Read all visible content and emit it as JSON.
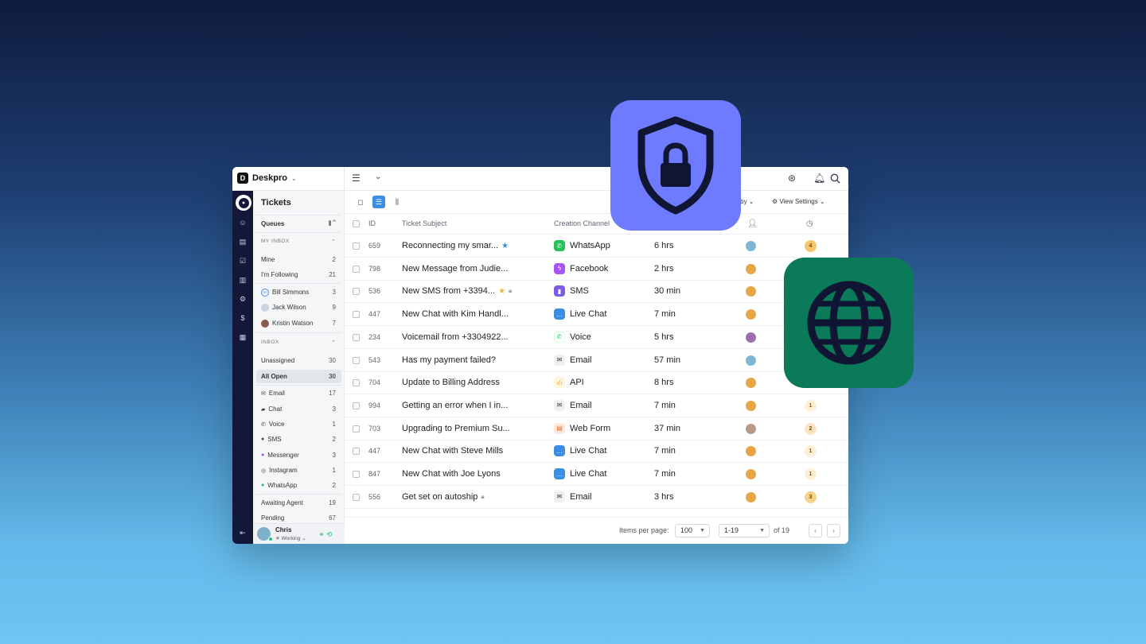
{
  "app": {
    "name": "Deskpro",
    "section": "Tickets"
  },
  "colors": {
    "nav_bg": "#13183a",
    "accent": "#3b8ee3",
    "shield_tile": "#6e7bff",
    "globe_tile": "#0a7a58"
  },
  "queues": {
    "title": "Queues",
    "my_inbox_header": "MY INBOX",
    "inbox_header": "INBOX",
    "my_inbox": [
      {
        "label": "Mine",
        "count": "2"
      },
      {
        "label": "I'm Following",
        "count": "21"
      }
    ],
    "agents": [
      {
        "label": "Bill Simmons",
        "count": "3",
        "initials": "BS"
      },
      {
        "label": "Jack Wilson",
        "count": "9"
      },
      {
        "label": "Kristin Watson",
        "count": "7"
      }
    ],
    "inbox": [
      {
        "label": "Unassigned",
        "count": "30"
      },
      {
        "label": "All Open",
        "count": "30"
      }
    ],
    "channels": [
      {
        "label": "Email",
        "count": "17",
        "icon": "email-icon"
      },
      {
        "label": "Chat",
        "count": "3",
        "icon": "chat-icon"
      },
      {
        "label": "Voice",
        "count": "1",
        "icon": "phone-icon"
      },
      {
        "label": "SMS",
        "count": "2",
        "icon": "sms-icon"
      },
      {
        "label": "Messenger",
        "count": "3",
        "icon": "messenger-icon"
      },
      {
        "label": "Instagram",
        "count": "1",
        "icon": "instagram-icon"
      },
      {
        "label": "WhatsApp",
        "count": "2",
        "icon": "whatsapp-icon"
      }
    ],
    "other": [
      {
        "label": "Awaiting Agent",
        "count": "19"
      },
      {
        "label": "Pending",
        "count": "67"
      }
    ]
  },
  "user": {
    "name": "Chris",
    "status": "Working"
  },
  "toolbar": {
    "group_by": "up by",
    "view_settings": "View Settings"
  },
  "table": {
    "headers": {
      "id": "ID",
      "subject": "Ticket Subject",
      "channel": "Creation Channel"
    },
    "rows": [
      {
        "id": "659",
        "subject": "Reconnecting my smar...",
        "star": true,
        "lock": false,
        "channel": "WhatsApp",
        "time": "6 hrs",
        "badge": "4"
      },
      {
        "id": "798",
        "subject": "New Message from Judie...",
        "star": false,
        "lock": false,
        "channel": "Facebook",
        "time": "2 hrs",
        "badge": ""
      },
      {
        "id": "536",
        "subject": "New SMS from +3394...",
        "star": true,
        "lock": true,
        "channel": "SMS",
        "time": "30 min",
        "badge": ""
      },
      {
        "id": "447",
        "subject": "New Chat with Kim Handl...",
        "star": false,
        "lock": false,
        "channel": "Live Chat",
        "time": "7 min",
        "badge": ""
      },
      {
        "id": "234",
        "subject": "Voicemail from +3304922...",
        "star": false,
        "lock": false,
        "channel": "Voice",
        "time": "5 hrs",
        "badge": ""
      },
      {
        "id": "543",
        "subject": "Has my payment failed?",
        "star": false,
        "lock": false,
        "channel": "Email",
        "time": "57 min",
        "badge": ""
      },
      {
        "id": "704",
        "subject": "Update to Billing Address",
        "star": false,
        "lock": false,
        "channel": "API",
        "time": "8 hrs",
        "badge": ""
      },
      {
        "id": "994",
        "subject": "Getting an error when I in...",
        "star": false,
        "lock": false,
        "channel": "Email",
        "time": "7 min",
        "badge": "1"
      },
      {
        "id": "703",
        "subject": "Upgrading to Premium Su...",
        "star": false,
        "lock": false,
        "channel": "Web Form",
        "time": "37 min",
        "badge": "2"
      },
      {
        "id": "447",
        "subject": "New Chat with Steve Mills",
        "star": false,
        "lock": false,
        "channel": "Live Chat",
        "time": "7 min",
        "badge": "1"
      },
      {
        "id": "847",
        "subject": "New Chat with Joe Lyons",
        "star": false,
        "lock": false,
        "channel": "Live Chat",
        "time": "7 min",
        "badge": "1"
      },
      {
        "id": "556",
        "subject": "Get set on autoship",
        "star": false,
        "lock": true,
        "channel": "Email",
        "time": "3 hrs",
        "badge": "3"
      }
    ]
  },
  "footer": {
    "items_label": "Items per page:",
    "per_page": "100",
    "range": "1-19",
    "of": "of 19"
  }
}
